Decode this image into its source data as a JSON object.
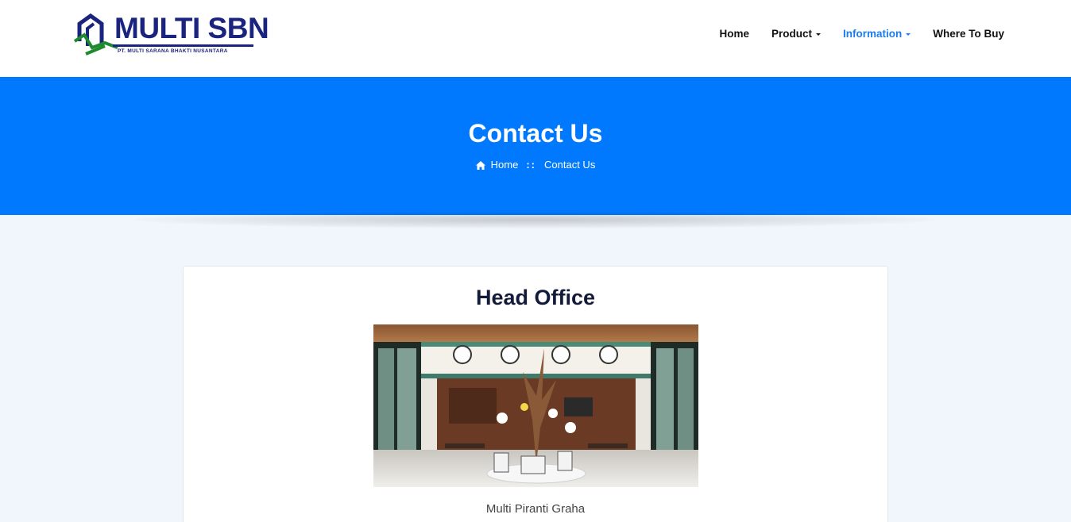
{
  "brand": {
    "name": "MULTI SBN",
    "tagline": "PT. MULTI SARANA BHAKTI NUSANTARA",
    "colors": {
      "primary": "#1a237e",
      "accent": "#1e8a2e"
    }
  },
  "nav": {
    "items": [
      {
        "label": "Home",
        "dropdown": false,
        "active": false
      },
      {
        "label": "Product",
        "dropdown": true,
        "active": false
      },
      {
        "label": "Information",
        "dropdown": true,
        "active": true
      },
      {
        "label": "Where To Buy",
        "dropdown": false,
        "active": false
      }
    ],
    "active_color": "#1a7cf0"
  },
  "banner": {
    "title": "Contact Us",
    "background": "#0079fe",
    "breadcrumb": {
      "icon": "home-icon",
      "home": "Home",
      "separator": "::",
      "current": "Contact Us"
    }
  },
  "main": {
    "section_title": "Head Office",
    "photo_caption": "Multi Piranti Graha"
  }
}
